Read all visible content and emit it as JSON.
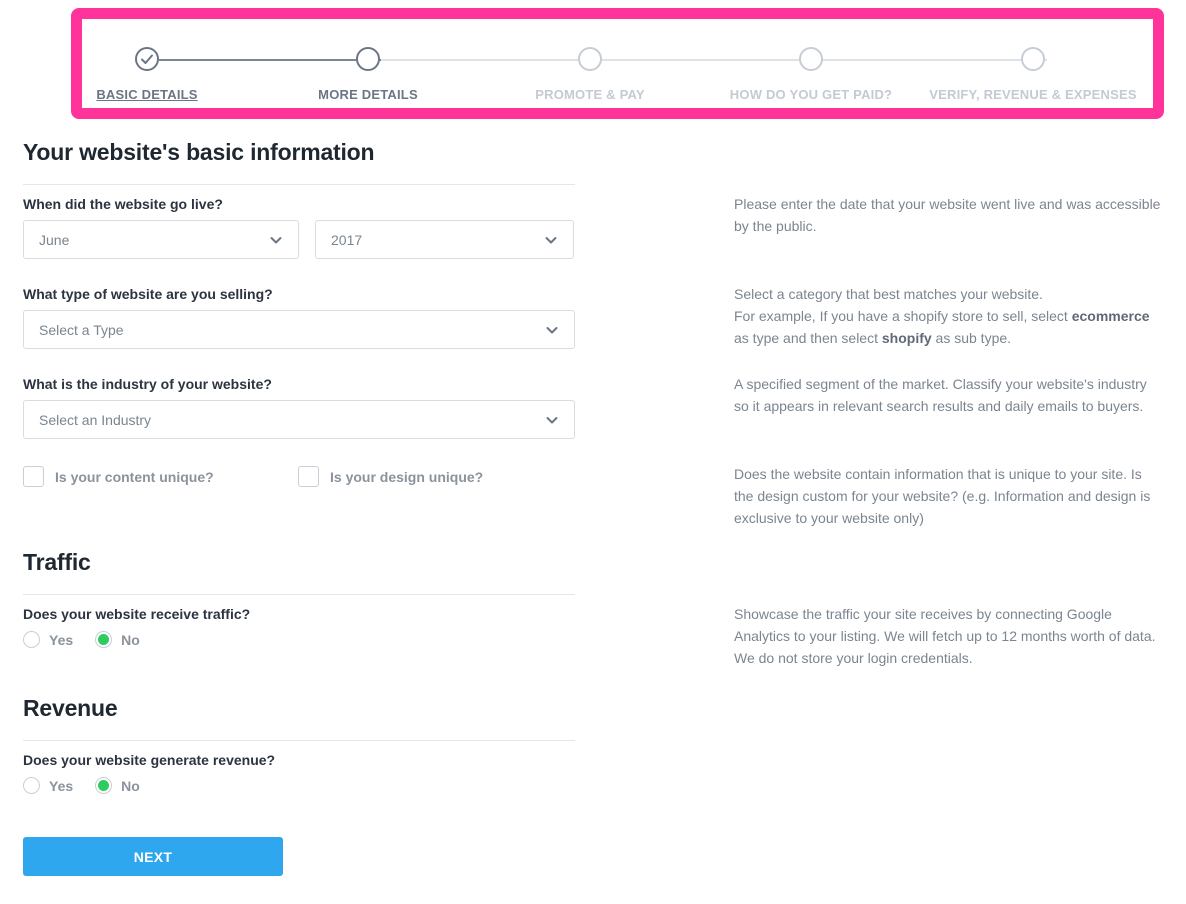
{
  "stepper": {
    "steps": [
      {
        "label": "BASIC DETAILS",
        "state": "done"
      },
      {
        "label": "MORE DETAILS",
        "state": "active"
      },
      {
        "label": "PROMOTE & PAY",
        "state": "todo"
      },
      {
        "label": "HOW DO YOU GET PAID?",
        "state": "todo"
      },
      {
        "label": "VERIFY, REVENUE & EXPENSES",
        "state": "todo"
      }
    ],
    "highlight_color": "#ff3399"
  },
  "basic_info": {
    "title": "Your website's basic information",
    "live_date": {
      "question": "When did the website go live?",
      "month_value": "June",
      "year_value": "2017",
      "help": "Please enter the date that your website went live and was accessible by the public."
    },
    "type": {
      "question": "What type of website are you selling?",
      "placeholder": "Select a Type",
      "help_line1": "Select a category that best matches your website.",
      "help_line2_prefix": "For example, If you have a shopify store to sell, select ",
      "help_bold1": "ecommerce",
      "help_mid": " as type and then select ",
      "help_bold2": "shopify",
      "help_suffix": " as sub type."
    },
    "industry": {
      "question": "What is the industry of your website?",
      "placeholder": "Select an Industry",
      "help": "A specified segment of the market. Classify your website's industry so it appears in relevant search results and daily emails to buyers."
    },
    "unique": {
      "content_label": "Is your content unique?",
      "content_checked": false,
      "design_label": "Is your design unique?",
      "design_checked": false,
      "help": "Does the website contain information that is unique to your site. Is the design custom for your website? (e.g. Information and design is exclusive to your website only)"
    }
  },
  "traffic": {
    "title": "Traffic",
    "question": "Does your website receive traffic?",
    "yes_label": "Yes",
    "no_label": "No",
    "selected": "No",
    "help": "Showcase the traffic your site receives by connecting Google Analytics to your listing. We will fetch up to 12 months worth of data. We do not store your login credentials."
  },
  "revenue": {
    "title": "Revenue",
    "question": "Does your website generate revenue?",
    "yes_label": "Yes",
    "no_label": "No",
    "selected": "No"
  },
  "next_label": "NEXT",
  "colors": {
    "accent": "#2fa7ee",
    "radio_selected": "#2ecc5f"
  }
}
